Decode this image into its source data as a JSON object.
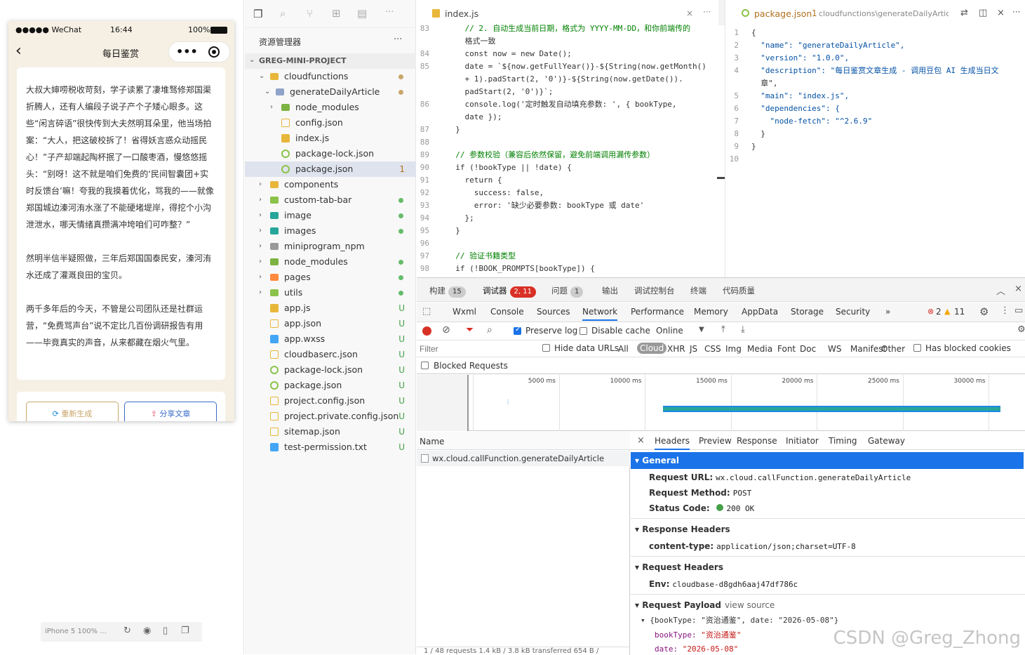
{
  "simulator": {
    "status": {
      "carrier": "●●●●● WeChat",
      "time": "16:44",
      "battery": "100%"
    },
    "nav_title": "每日鉴赏",
    "article": [
      "大叔大婶唠税收苛刻，学子读累了凄堆驽修郑国渠折腾人，还有人编段子说子产个子矮心眼多。这些“闲言碎语”很快传到大夫然明耳朵里，他当场拍案：“大人，把这破校拆了！省得妖言惑众动摇民心！”子产却端起陶杯抿了一口酸枣酒，慢悠悠摇头：“别呀！这不就是咱们免费的‘民间智囊团+实时反馈台’嘛！夸我的我摸着优化，骂我的——就像郑国城边溱河洧水涨了不能硬堵堤岸，得挖个小沟泄泄水，哪天情绪真攒满冲垮咱们可咋整？”",
      "然明半信半疑照做，三年后郑国国泰民安，溱河洧水还成了灌溉良田的宝贝。",
      "两千多年后的今天，不管是公司团队还是社群运营，“免费骂声台”说不定比几百份调研报告有用——毕竟真实的声音，从来都藏在烟火气里。"
    ],
    "btn_regenerate": "重新生成",
    "btn_share": "分享文章",
    "device": "iPhone 5 100% ..."
  },
  "explorer": {
    "title": "资源管理器",
    "more": "···",
    "project": "GREG-MINI-PROJECT",
    "items": [
      {
        "name": "cloudfunctions",
        "badge": ""
      },
      {
        "name": "generateDailyArticle",
        "badge": ""
      },
      {
        "name": "node_modules",
        "badge": ""
      },
      {
        "name": "config.json",
        "badge": ""
      },
      {
        "name": "index.js",
        "badge": ""
      },
      {
        "name": "package-lock.json",
        "badge": ""
      },
      {
        "name": "package.json",
        "badge": "1"
      },
      {
        "name": "components",
        "badge": ""
      },
      {
        "name": "custom-tab-bar",
        "badge": ""
      },
      {
        "name": "image",
        "badge": ""
      },
      {
        "name": "images",
        "badge": ""
      },
      {
        "name": "miniprogram_npm",
        "badge": ""
      },
      {
        "name": "node_modules",
        "badge": ""
      },
      {
        "name": "pages",
        "badge": ""
      },
      {
        "name": "utils",
        "badge": ""
      },
      {
        "name": "app.js",
        "badge": "U"
      },
      {
        "name": "app.json",
        "badge": "U"
      },
      {
        "name": "app.wxss",
        "badge": "U"
      },
      {
        "name": "cloudbaserc.json",
        "badge": "U"
      },
      {
        "name": "package-lock.json",
        "badge": "U"
      },
      {
        "name": "package.json",
        "badge": "U"
      },
      {
        "name": "project.config.json",
        "badge": "U"
      },
      {
        "name": "project.private.config.json",
        "badge": "U"
      },
      {
        "name": "sitemap.json",
        "badge": "U"
      },
      {
        "name": "test-permission.txt",
        "badge": "U"
      }
    ]
  },
  "editor1": {
    "tab": "index.js",
    "lines": [
      {
        "n": "83",
        "t": "    // 2. 自动生成当前日期，格式为 YYYY-MM-DD，和你前端传的"
      },
      {
        "n": "",
        "t": "    格式一致"
      },
      {
        "n": "84",
        "t": "    const now = new Date();"
      },
      {
        "n": "85",
        "t": "    date = `${now.getFullYear()}-${String(now.getMonth()"
      },
      {
        "n": "",
        "t": "    + 1).padStart(2, '0')}-${String(now.getDate())."
      },
      {
        "n": "",
        "t": "    padStart(2, '0')}`;"
      },
      {
        "n": "86",
        "t": "    console.log('定时触发自动填充参数: ', { bookType,"
      },
      {
        "n": "",
        "t": "    date });"
      },
      {
        "n": "87",
        "t": "  }"
      },
      {
        "n": "88",
        "t": ""
      },
      {
        "n": "89",
        "t": "  // 参数校验（兼容后依然保留，避免前端调用漏传参数）"
      },
      {
        "n": "90",
        "t": "  if (!bookType || !date) {"
      },
      {
        "n": "91",
        "t": "    return {"
      },
      {
        "n": "92",
        "t": "      success: false,"
      },
      {
        "n": "93",
        "t": "      error: '缺少必要参数: bookType 或 date'"
      },
      {
        "n": "94",
        "t": "    };"
      },
      {
        "n": "95",
        "t": "  }"
      },
      {
        "n": "96",
        "t": ""
      },
      {
        "n": "97",
        "t": "  // 验证书籍类型"
      },
      {
        "n": "98",
        "t": "  if (!BOOK_PROMPTS[bookType]) {"
      }
    ]
  },
  "editor2": {
    "tab": "package.json",
    "tab_badge": "1",
    "tab_path": "cloudfunctions\\generateDailyArticle\\p",
    "lines": [
      {
        "n": "1",
        "t": "{"
      },
      {
        "n": "2",
        "t": "  \"name\": \"generateDailyArticle\","
      },
      {
        "n": "3",
        "t": "  \"version\": \"1.0.0\","
      },
      {
        "n": "4",
        "t": "  \"description\": \"每日鉴赏文章生成 - 调用豆包 AI 生成当日文"
      },
      {
        "n": "",
        "t": "  章\","
      },
      {
        "n": "5",
        "t": "  \"main\": \"index.js\","
      },
      {
        "n": "6",
        "t": "  \"dependencies\": {"
      },
      {
        "n": "7",
        "t": "    \"node-fetch\": \"^2.6.9\""
      },
      {
        "n": "8",
        "t": "  }"
      },
      {
        "n": "9",
        "t": "}"
      },
      {
        "n": "10",
        "t": ""
      }
    ]
  },
  "devtools": {
    "top_tabs": [
      {
        "label": "构建",
        "count": "15"
      },
      {
        "label": "调试器",
        "count": "2, 11"
      },
      {
        "label": "问题",
        "count": "1"
      },
      {
        "label": "输出",
        "count": ""
      },
      {
        "label": "调试控制台",
        "count": ""
      },
      {
        "label": "终端",
        "count": ""
      },
      {
        "label": "代码质量",
        "count": ""
      }
    ],
    "panels": [
      "Wxml",
      "Console",
      "Sources",
      "Network",
      "Performance",
      "Memory",
      "AppData",
      "Storage",
      "Security",
      "»"
    ],
    "errors": "2",
    "warnings": "11",
    "preserve_log": "Preserve log",
    "disable_cache": "Disable cache",
    "throttle": "Online",
    "filter_placeholder": "Filter",
    "hide_data_urls": "Hide data URLs",
    "types": [
      "All",
      "Cloud",
      "XHR",
      "JS",
      "CSS",
      "Img",
      "Media",
      "Font",
      "Doc",
      "WS",
      "Manifest",
      "Other"
    ],
    "has_blocked": "Has blocked cookies",
    "blocked_requests": "Blocked Requests",
    "ticks": [
      "5000 ms",
      "10000 ms",
      "15000 ms",
      "20000 ms",
      "25000 ms",
      "30000 ms",
      "35000 ms"
    ],
    "name_header": "Name",
    "request_name": "wx.cloud.callFunction.generateDailyArticle",
    "status_footer": "1 / 48 requests   1.4 kB / 3.8 kB transferred   654 B /",
    "detail_tabs": [
      "Headers",
      "Preview",
      "Response",
      "Initiator",
      "Timing",
      "Gateway"
    ],
    "general": {
      "title": "General",
      "request_url_k": "Request URL:",
      "request_url_v": "wx.cloud.callFunction.generateDailyArticle",
      "method_k": "Request Method:",
      "method_v": "POST",
      "status_k": "Status Code:",
      "status_v": "200 OK"
    },
    "response_headers": {
      "title": "Response Headers",
      "k": "content-type:",
      "v": "application/json;charset=UTF-8"
    },
    "request_headers": {
      "title": "Request Headers",
      "k": "Env:",
      "v": "cloudbase-d8gdh6aaj47df786c"
    },
    "payload": {
      "title": "Request Payload",
      "view_source": "view source",
      "summary": "{bookType: \"资治通鉴\", date: \"2026-05-08\"}",
      "booktype_k": "bookType:",
      "booktype_v": "\"资治通鉴\"",
      "date_k": "date:",
      "date_v": "\"2026-05-08\""
    }
  },
  "watermark": "CSDN @Greg_Zhong",
  "colors": {
    "accent": "#1a73e8",
    "brand_gold": "#c9a66b",
    "green": "#43a047"
  }
}
